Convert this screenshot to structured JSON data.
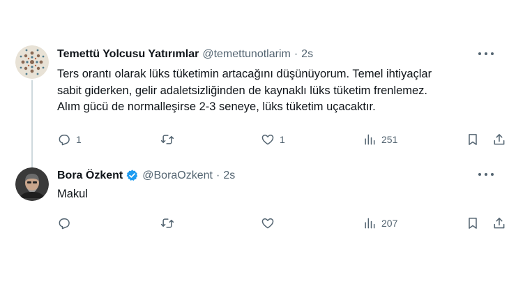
{
  "tweets": [
    {
      "name": "Temettü Yolcusu Yatırımlar",
      "handle": "@temettunotlarim",
      "separator": "·",
      "time": "2s",
      "text_lines": [
        "Ters orantı olarak lüks tüketimin artacağını düşünüyorum. Temel ihtiyaçlar",
        "sabit giderken, gelir adaletsizliğinden de kaynaklı lüks tüketim frenlemez.",
        "Alım gücü de normalleşirse 2-3 seneye, lüks tüketim uçacaktır."
      ],
      "reply_count": "1",
      "retweet_count": "",
      "like_count": "1",
      "view_count": "251",
      "verified": false
    },
    {
      "name": "Bora Özkent",
      "handle": "@BoraOzkent",
      "separator": "·",
      "time": "2s",
      "text_lines": [
        "Makul"
      ],
      "reply_count": "",
      "retweet_count": "",
      "like_count": "",
      "view_count": "207",
      "verified": true
    }
  ],
  "icons": {
    "reply": "reply-icon",
    "retweet": "retweet-icon",
    "like": "heart-icon",
    "views": "views-icon",
    "bookmark": "bookmark-icon",
    "share": "share-icon",
    "more": "more-icon",
    "verified": "verified-badge-icon"
  },
  "colors": {
    "text": "#0f1419",
    "secondary": "#536471",
    "thread_line": "#cfd9de",
    "verified": "#1d9bf0"
  }
}
